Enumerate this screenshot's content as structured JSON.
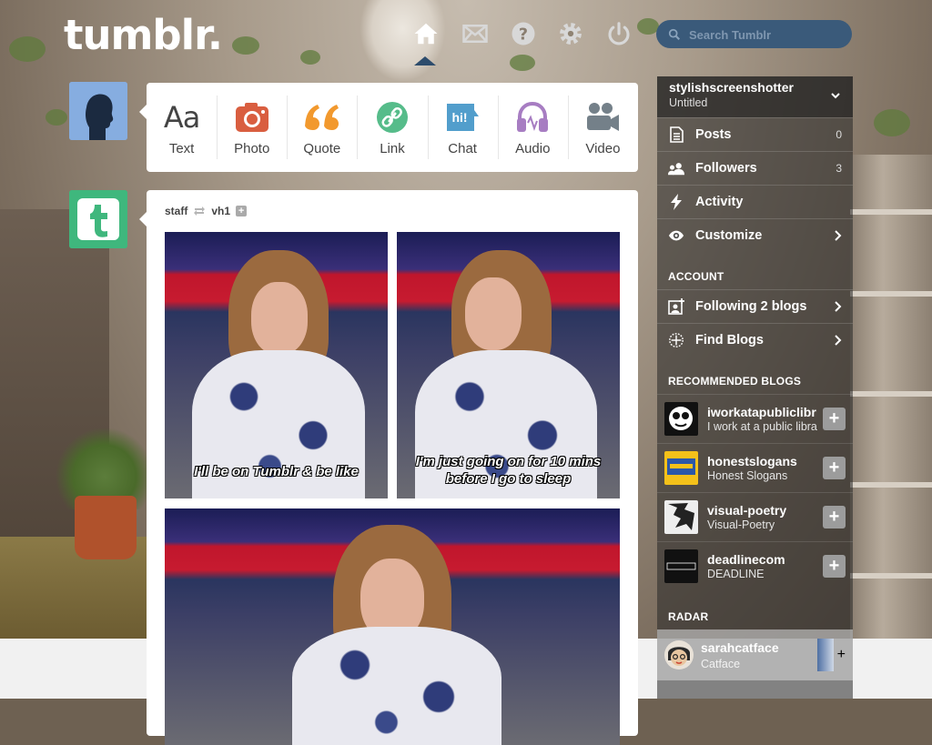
{
  "header": {
    "logo": "tumblr.",
    "search_placeholder": "Search Tumblr",
    "nav_icons": [
      "home-icon",
      "mail-icon",
      "help-icon",
      "gear-icon",
      "power-icon"
    ]
  },
  "composer": {
    "types": [
      {
        "label": "Text",
        "icon": "text-icon",
        "color": "#444444"
      },
      {
        "label": "Photo",
        "icon": "camera-icon",
        "color": "#d95e40"
      },
      {
        "label": "Quote",
        "icon": "quote-icon",
        "color": "#f2992e"
      },
      {
        "label": "Link",
        "icon": "link-icon",
        "color": "#56bc8a"
      },
      {
        "label": "Chat",
        "icon": "chat-icon",
        "color": "#529ecc"
      },
      {
        "label": "Audio",
        "icon": "headphones-icon",
        "color": "#a77dc2"
      },
      {
        "label": "Video",
        "icon": "video-camera-icon",
        "color": "#748089"
      }
    ]
  },
  "post": {
    "author": "staff",
    "reblogged_from": "vh1",
    "captions": [
      "I'll be on Tumblr & be like",
      "I'm just going on for 10 mins before I go to sleep"
    ]
  },
  "sidebar": {
    "blog_name": "stylishscreenshotter",
    "blog_title": "Untitled",
    "items": [
      {
        "label": "Posts",
        "count": "0",
        "icon": "posts-icon"
      },
      {
        "label": "Followers",
        "count": "3",
        "icon": "followers-icon"
      },
      {
        "label": "Activity",
        "count": "",
        "icon": "lightning-icon"
      },
      {
        "label": "Customize",
        "count": "",
        "icon": "eye-icon"
      }
    ],
    "account_heading": "ACCOUNT",
    "account_items": [
      {
        "label": "Following 2 blogs",
        "icon": "following-icon"
      },
      {
        "label": "Find Blogs",
        "icon": "compass-icon"
      }
    ],
    "recommended_heading": "RECOMMENDED BLOGS",
    "recommended": [
      {
        "name": "iworkatapubliclibr",
        "desc": "I work at a public libra"
      },
      {
        "name": "honestslogans",
        "desc": "Honest Slogans"
      },
      {
        "name": "visual-poetry",
        "desc": "Visual-Poetry"
      },
      {
        "name": "deadlinecom",
        "desc": "DEADLINE"
      }
    ],
    "radar_heading": "RADAR",
    "radar": {
      "name": "sarahcatface",
      "desc": "Catface"
    }
  },
  "colors": {
    "accent": "#36465d",
    "search_bg": "#3a5a7a",
    "staff_green": "#3fb77d"
  }
}
